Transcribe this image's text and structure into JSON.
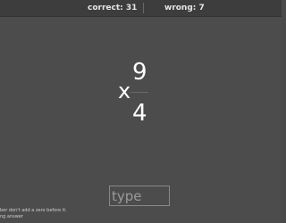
{
  "scoreboard": {
    "correct_label": "correct: 31",
    "wrong_label": "wrong: 7"
  },
  "problem": {
    "operator": "x",
    "top_number": "9",
    "bottom_number": "4"
  },
  "answer": {
    "placeholder": "type",
    "value": ""
  },
  "hints": {
    "line1": "ber don't add a zero before it.",
    "line2": "ng answer"
  },
  "colors": {
    "background": "#4c4c4c",
    "topbar": "#3d3d3d",
    "text": "#ffffff"
  }
}
